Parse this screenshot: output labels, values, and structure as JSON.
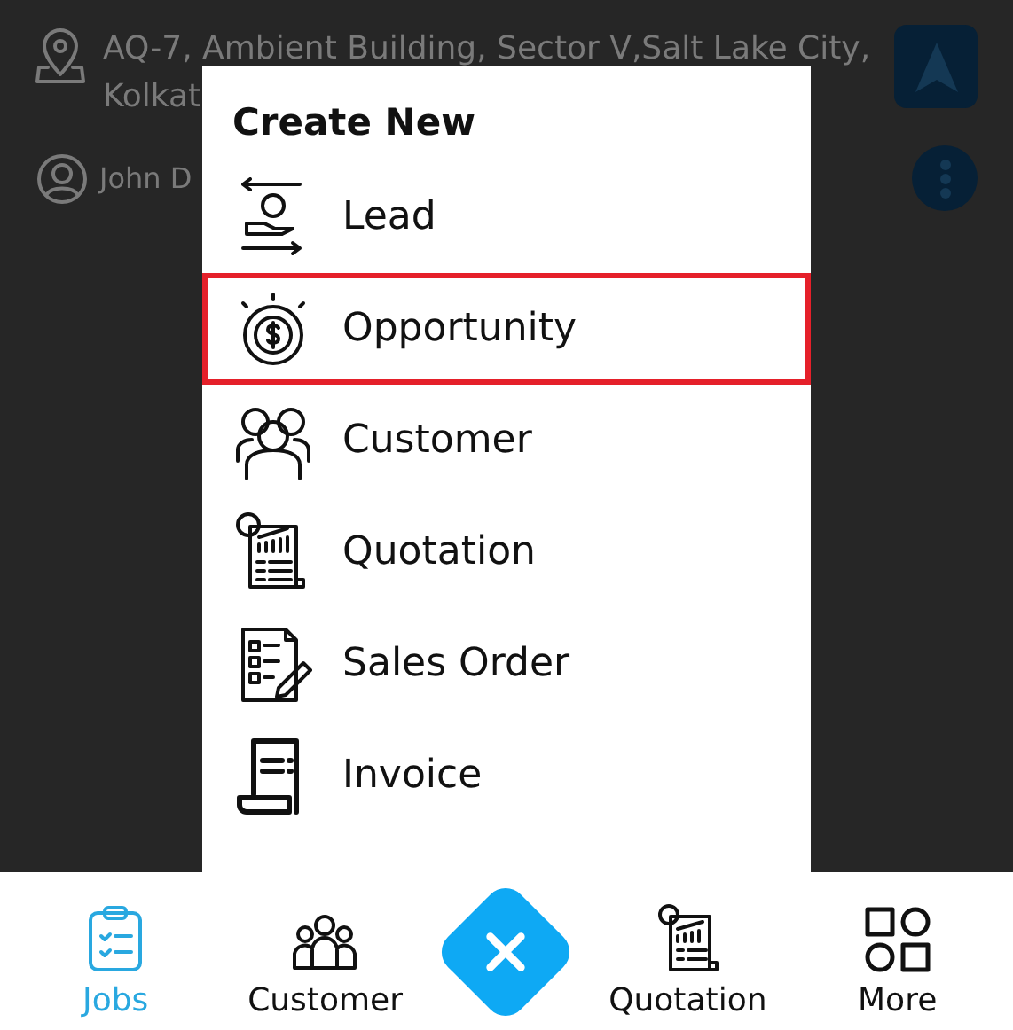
{
  "background": {
    "address_lines": [
      "AQ-7, Ambient Building, Sector V,Salt Lake City,",
      "Kolkat"
    ],
    "contact_name": "John D"
  },
  "dialog": {
    "title": "Create New",
    "items": [
      {
        "kind": "lead",
        "label": "Lead",
        "selected": false
      },
      {
        "kind": "opportunity",
        "label": "Opportunity",
        "selected": true
      },
      {
        "kind": "customer",
        "label": "Customer",
        "selected": false
      },
      {
        "kind": "quotation",
        "label": "Quotation",
        "selected": false
      },
      {
        "kind": "sales_order",
        "label": "Sales Order",
        "selected": false
      },
      {
        "kind": "invoice",
        "label": "Invoice",
        "selected": false
      }
    ]
  },
  "bottom_nav": {
    "items": [
      {
        "kind": "jobs",
        "label": "Jobs",
        "selected": true
      },
      {
        "kind": "customer",
        "label": "Customer",
        "selected": false
      },
      {
        "kind": "close"
      },
      {
        "kind": "quotation",
        "label": "Quotation",
        "selected": false
      },
      {
        "kind": "more",
        "label": "More",
        "selected": false
      }
    ]
  }
}
